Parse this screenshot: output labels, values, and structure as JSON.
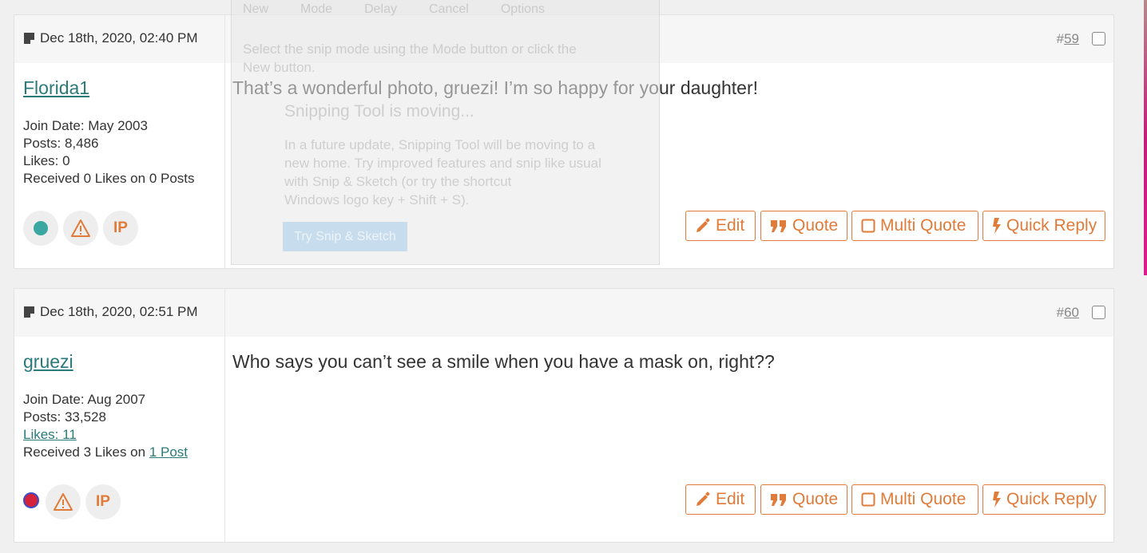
{
  "posts": [
    {
      "date": "Dec 18th, 2020, 02:40 PM",
      "post_number_hash": "#",
      "post_number": "59",
      "username": "Florida1",
      "join_date": "Join Date: May 2003",
      "posts": "Posts: 8,486",
      "likes": "Likes: 0",
      "received": "Received 0 Likes on 0 Posts",
      "status": "online",
      "message": "That’s a wonderful photo, gruezi! I’m so happy for your daughter!"
    },
    {
      "date": "Dec 18th, 2020, 02:51 PM",
      "post_number_hash": "#",
      "post_number": "60",
      "username": "gruezi",
      "join_date": "Join Date: Aug 2007",
      "posts": "Posts: 33,528",
      "likes": "Likes: 11",
      "received_prefix": "Received 3 Likes on ",
      "received_link": "1 Post",
      "status": "offline",
      "message": "Who says you can’t see a smile when you have a mask on, right??"
    }
  ],
  "buttons": {
    "edit": "Edit",
    "quote": "Quote",
    "multi_quote": "Multi Quote",
    "quick_reply": "Quick Reply",
    "ip": "IP"
  },
  "overlay": {
    "instruction": "Select the snip mode using the Mode button or click the New button.",
    "title": "Snipping Tool is moving...",
    "body_lines": [
      "In a future update, Snipping Tool will be moving to a",
      "new home. Try improved features and snip like usual",
      "with Snip & Sketch (or try the shortcut",
      "Windows logo key + Shift + S)."
    ],
    "try_button": "Try Snip & Sketch",
    "toolbar": [
      "New",
      "Mode",
      "Delay",
      "Cancel",
      "Options"
    ]
  },
  "colors": {
    "accent": "#e07b39",
    "link": "#2b7a7a",
    "online": "#3aa7a3",
    "offline": "#d4223a"
  }
}
